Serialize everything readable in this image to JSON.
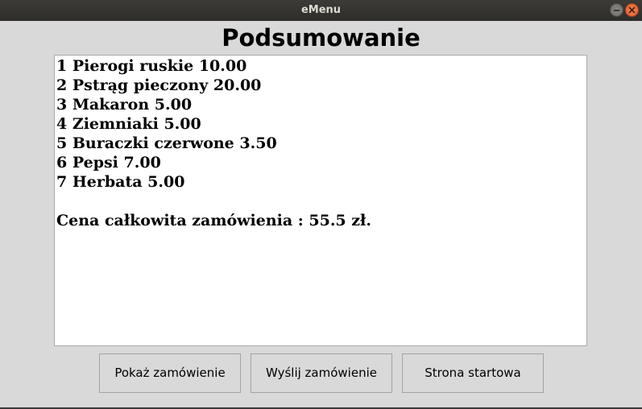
{
  "window": {
    "title": "eMenu"
  },
  "heading": "Podsumowanie",
  "order": {
    "items": [
      "1 Pierogi ruskie 10.00",
      "2 Pstrąg pieczony 20.00",
      "3 Makaron 5.00",
      "4 Ziemniaki 5.00",
      "5 Buraczki czerwone 3.50",
      "6 Pepsi 7.00",
      "7 Herbata 5.00"
    ],
    "total": "Cena całkowita zamówienia : 55.5 zł."
  },
  "buttons": {
    "show_order": "Pokaż zamówienie",
    "send_order": "Wyślij zamówienie",
    "start_page": "Strona startowa"
  }
}
